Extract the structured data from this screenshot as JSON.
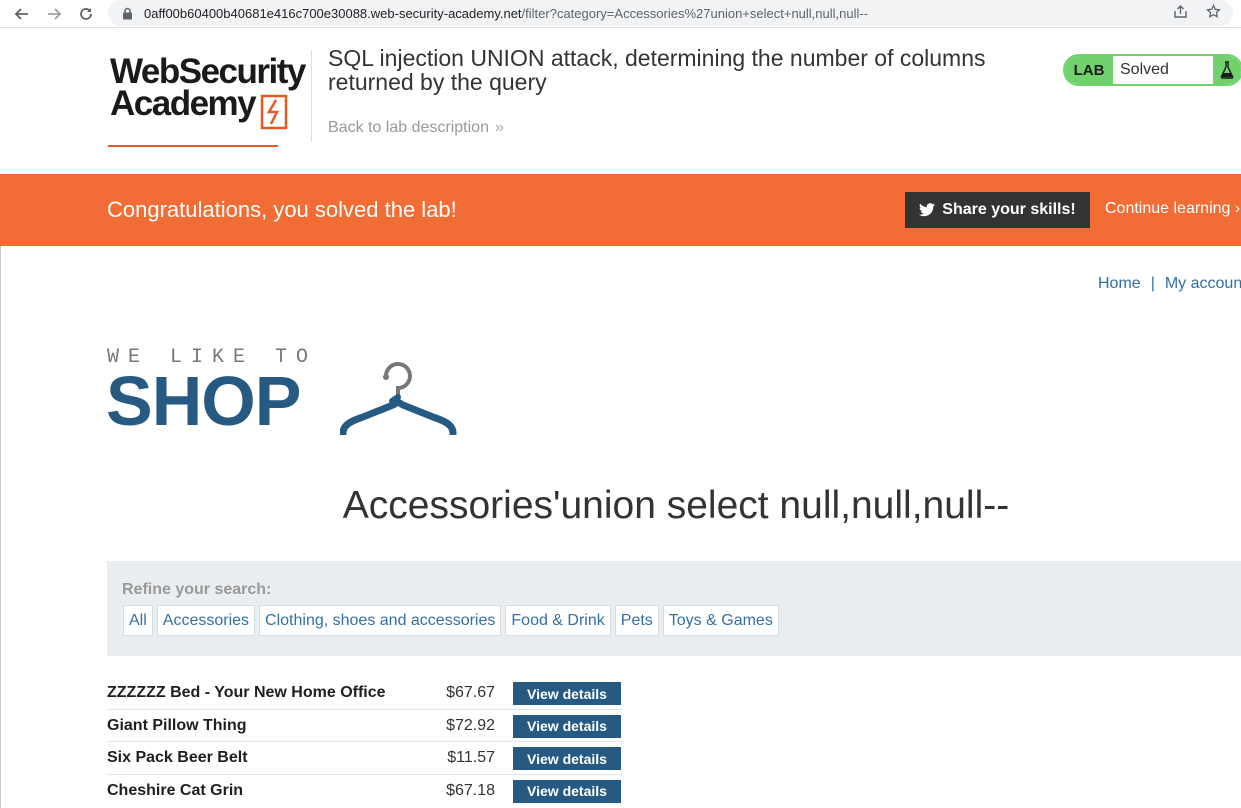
{
  "browser": {
    "url_host": "0aff00b60400b40681e416c700e30088.web-security-academy.net",
    "url_path": "/filter?category=Accessories%27union+select+null,null,null--",
    "icons": [
      "arrow-left-icon",
      "arrow-right-icon",
      "reload-icon",
      "lock-icon",
      "share-icon",
      "star-icon"
    ]
  },
  "header": {
    "logo_line1": "WebSecurity",
    "logo_line2": "Academy",
    "lab_title": "SQL injection UNION attack, determining the number of columns returned by the query",
    "back_link": "Back to lab description",
    "back_link_chevron": "»",
    "lab_badge": "LAB",
    "lab_status": "Solved"
  },
  "banner": {
    "message": "Congratulations, you solved the lab!",
    "share_label": "Share your skills!",
    "continue_label": "Continue learning",
    "continue_chevron": "›"
  },
  "nav": {
    "home": "Home",
    "separator": "|",
    "account": "My account"
  },
  "shop_logo": {
    "tagline": "WE LIKE TO",
    "word": "SHOP"
  },
  "page": {
    "heading": "Accessories'union select null,null,null--"
  },
  "filters": {
    "label": "Refine your search:",
    "items": [
      "All",
      "Accessories",
      "Clothing, shoes and accessories",
      "Food & Drink",
      "Pets",
      "Toys & Games"
    ]
  },
  "products": {
    "button_label": "View details",
    "rows": [
      {
        "name": "ZZZZZZ Bed - Your New Home Office",
        "price": "$67.67"
      },
      {
        "name": "Giant Pillow Thing",
        "price": "$72.92"
      },
      {
        "name": "Six Pack Beer Belt",
        "price": "$11.57"
      },
      {
        "name": "Cheshire Cat Grin",
        "price": "$67.18"
      }
    ]
  },
  "colors": {
    "banner": "#f26d35",
    "lab_green": "#70d16d",
    "link_blue": "#356fa5",
    "shop_blue": "#275a82",
    "button_dark": "#333332"
  }
}
